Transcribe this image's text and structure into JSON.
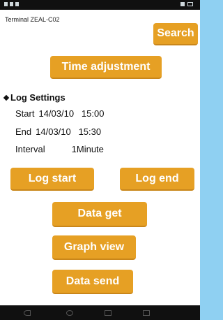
{
  "terminal": {
    "label": "Terminal ZEAL-C02"
  },
  "buttons": {
    "search": "Search",
    "time_adjustment": "Time adjustment",
    "log_start": "Log start",
    "log_end": "Log end",
    "data_get": "Data get",
    "graph_view": "Graph view",
    "data_send": "Data send"
  },
  "log_settings": {
    "title": "Log Settings",
    "start_label": "Start",
    "start_value": "14/03/10   15:00",
    "end_label": "End",
    "end_value": "14/03/10   15:30",
    "interval_label": "Interval",
    "interval_value": "1Minute"
  },
  "colors": {
    "button_bg": "#e6a024",
    "button_text": "#ffffff",
    "frame": "#8fd0f2"
  },
  "icons": [
    "wifi-icon",
    "battery-icon",
    "back-icon",
    "home-icon",
    "recent-apps-icon",
    "menu-icon"
  ]
}
